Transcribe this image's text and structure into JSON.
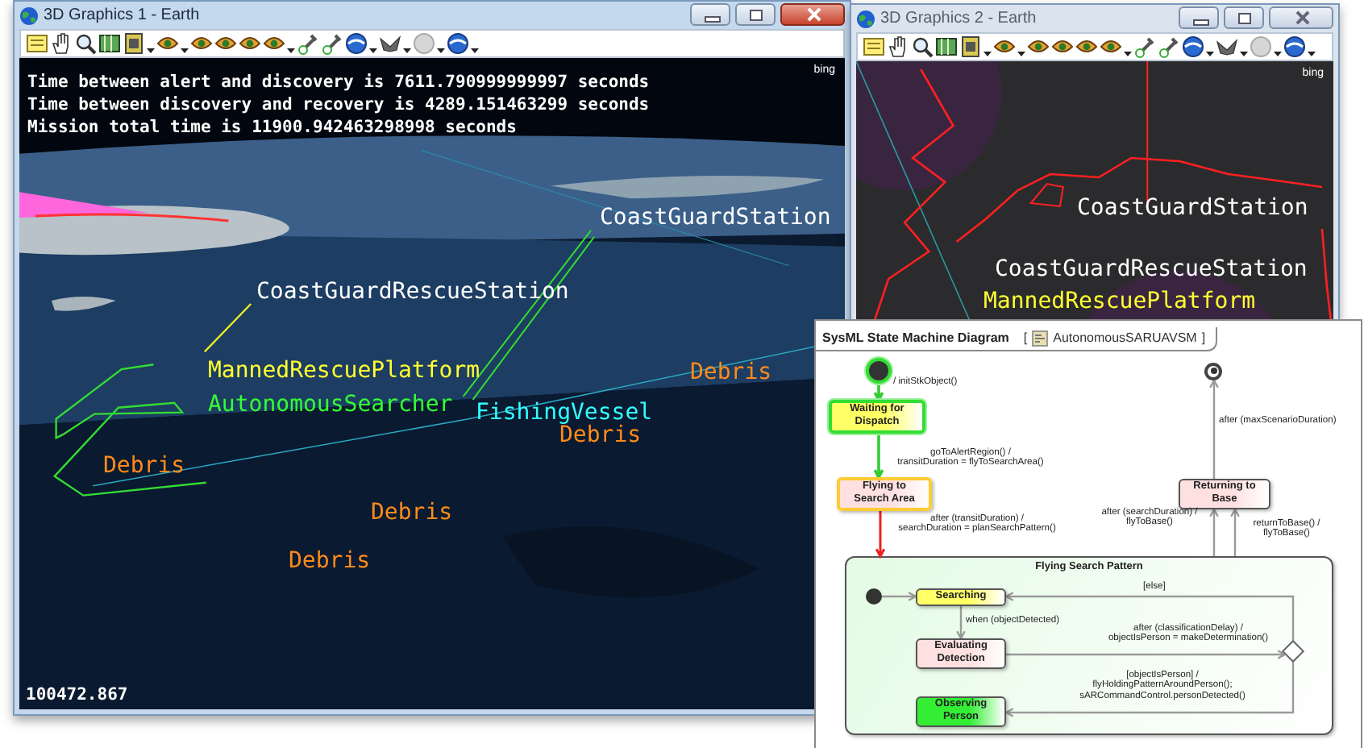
{
  "windows": [
    {
      "title": "3D Graphics 1 - Earth",
      "active": true,
      "logo": "bing",
      "overlay_text": [
        "Time between alert and discovery is 7611.790999999997 seconds",
        "Time between discovery and recovery is 4289.151463299 seconds",
        "Mission total time is 11900.942463298998 seconds"
      ],
      "labels": [
        {
          "text": "CoastGuardStation",
          "color": "#ffffff"
        },
        {
          "text": "CoastGuardRescueStation",
          "color": "#ffffff"
        },
        {
          "text": "MannedRescuePlatform",
          "color": "#ffff33"
        },
        {
          "text": "AutonomousSearcher",
          "color": "#33ff33"
        },
        {
          "text": "FishingVessel",
          "color": "#33ffff"
        },
        {
          "text": "Debris",
          "color": "#ff8a1a"
        },
        {
          "text": "Debris",
          "color": "#ff8a1a"
        },
        {
          "text": "Debris",
          "color": "#ff8a1a"
        },
        {
          "text": "Debris",
          "color": "#ff8a1a"
        },
        {
          "text": "Debris",
          "color": "#ff8a1a"
        }
      ],
      "readout": "100472.867"
    },
    {
      "title": "3D Graphics 2 - Earth",
      "active": false,
      "logo": "bing",
      "labels": [
        {
          "text": "CoastGuardStation",
          "color": "#ffffff"
        },
        {
          "text": "CoastGuardRescueStation",
          "color": "#ffffff"
        },
        {
          "text": "MannedRescuePlatform",
          "color": "#ffff33"
        }
      ]
    }
  ],
  "diagram": {
    "title": "SysML State Machine Diagram",
    "bracket_open": "[",
    "name": "AutonomousSARUAVSM",
    "bracket_close": "]",
    "nodes": [
      {
        "kind": "initial",
        "visited": true,
        "current": false
      },
      {
        "kind": "state",
        "label": "Waiting for\nDispatch",
        "color": "#ffff66",
        "visited": true,
        "current": false
      },
      {
        "kind": "state",
        "label": "Flying to\nSearch Area",
        "color": "#ffe0e0",
        "visited": false,
        "current": true
      },
      {
        "kind": "final",
        "visited": false,
        "current": false
      },
      {
        "kind": "state",
        "label": "Returning to\nBase",
        "color": "#ffe0e0",
        "visited": false,
        "current": false
      },
      {
        "kind": "composite",
        "label": "Flying Search Pattern",
        "color": "#e4fbe4",
        "visited": false,
        "current": false
      },
      {
        "kind": "initial",
        "visited": false,
        "current": false
      },
      {
        "kind": "state",
        "label": "Searching",
        "color": "#ffff66",
        "visited": false,
        "current": false
      },
      {
        "kind": "state",
        "label": "Evaluating\nDetection",
        "color": "#ffe0e0",
        "visited": false,
        "current": false
      },
      {
        "kind": "state",
        "label": "Observing\nPerson",
        "color": "#33ee33",
        "visited": false,
        "current": false
      },
      {
        "kind": "choice",
        "visited": false,
        "current": false
      }
    ],
    "transitions": [
      {
        "label": "/ initStkObject()",
        "visited": true,
        "current": false
      },
      {
        "label": "goToAlertRegion() /\ntransitDuration = flyToSearchArea()",
        "visited": true,
        "current": false
      },
      {
        "label": "after (transitDuration) /\nsearchDuration = planSearchPattern()",
        "visited": false,
        "current": true
      },
      {
        "label": "after (maxScenarioDuration)",
        "visited": false,
        "current": false
      },
      {
        "label": "after (searchDuration) /\nflyToBase()",
        "visited": false,
        "current": false
      },
      {
        "label": "returnToBase() /\nflyToBase()",
        "visited": false,
        "current": false
      },
      {
        "visited": false,
        "current": false
      },
      {
        "label": "when (objectDetected)",
        "visited": false,
        "current": false
      },
      {
        "label": "after (classificationDelay) /\nobjectIsPerson = makeDetermination()",
        "visited": false,
        "current": false
      },
      {
        "label": "[else]",
        "visited": false,
        "current": false
      },
      {
        "label": "[objectIsPerson] /\nflyHoldingPatternAroundPerson();\nsARCommandControl.personDetected()",
        "visited": false,
        "current": false
      }
    ]
  }
}
